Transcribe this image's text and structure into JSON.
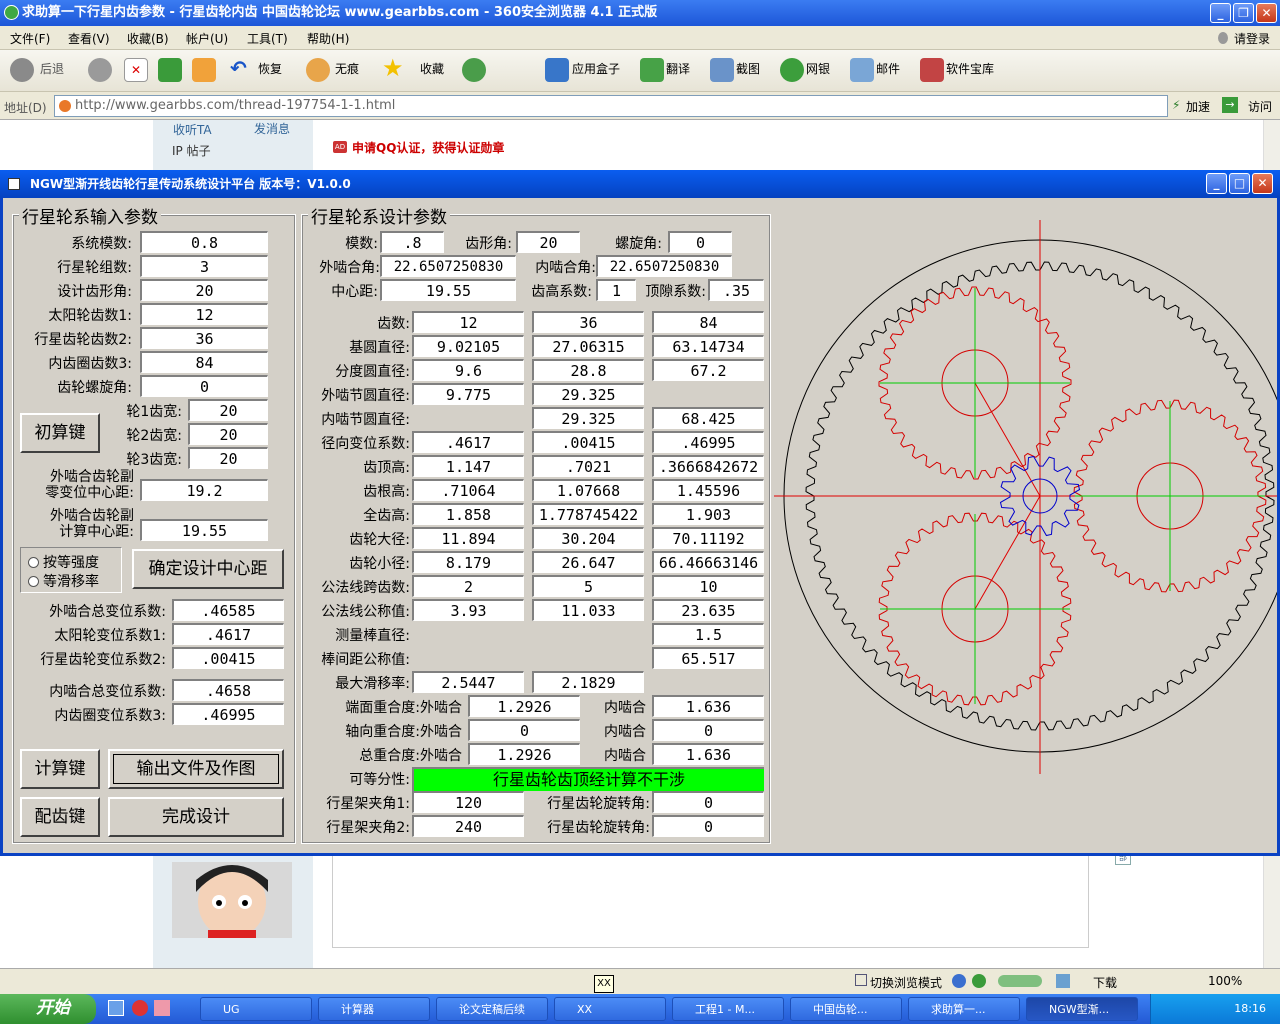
{
  "browser": {
    "title": "求助算一下行星内齿参数 - 行星齿轮内齿 中国齿轮论坛 www.gearbbs.com - 360安全浏览器 4.1 正式版",
    "menu": [
      "文件(F)",
      "查看(V)",
      "收藏(B)",
      "帐户(U)",
      "工具(T)",
      "帮助(H)"
    ],
    "login": "请登录",
    "toolbar": {
      "back": "后退",
      "restore": "恢复",
      "noTrace": "无痕",
      "favorites": "收藏",
      "appBox": "应用盒子",
      "translate": "翻译",
      "screenshot": "截图",
      "bank": "网银",
      "mail": "邮件",
      "softLib": "软件宝库"
    },
    "address_label": "地址(D)",
    "url": "http://www.gearbbs.com/thread-197754-1-1.html",
    "accelerate": "加速",
    "visit": "访问"
  },
  "web": {
    "listen": "收听TA",
    "message": "发消息",
    "ip_posts": "IP 帖子",
    "qq_promo": "申请QQ认证，获得认证勋章",
    "ad_badge": "AD"
  },
  "statusbar": {
    "switch_mode": "切换浏览模式",
    "download": "下载",
    "zoom": "100%"
  },
  "taskbar": {
    "start": "开始",
    "tasks": [
      "UG",
      "计算器",
      "论文定稿后续",
      "XX",
      "工程1 - M...",
      "中国齿轮...",
      "求助算一...",
      "NGW型渐..."
    ],
    "time": "18:16",
    "tooltip": "XX"
  },
  "app": {
    "title": "NGW型渐开线齿轮行星传动系统设计平台   版本号：V1.0.0",
    "input_group": {
      "title": "行星轮系输入参数",
      "fields": [
        {
          "label": "系统模数:",
          "value": "0.8"
        },
        {
          "label": "行星轮组数:",
          "value": "3"
        },
        {
          "label": "设计齿形角:",
          "value": "20"
        },
        {
          "label": "太阳轮齿数1:",
          "value": "12"
        },
        {
          "label": "行星齿轮齿数2:",
          "value": "36"
        },
        {
          "label": "内齿圈齿数3:",
          "value": "84"
        },
        {
          "label": "齿轮螺旋角:",
          "value": "0"
        }
      ],
      "widths": [
        {
          "label": "轮1齿宽:",
          "value": "20"
        },
        {
          "label": "轮2齿宽:",
          "value": "20"
        },
        {
          "label": "轮3齿宽:",
          "value": "20"
        }
      ],
      "calc_button": "初算键",
      "zero_center_label_1": "外啮合齿轮副",
      "zero_center_label_2": "零变位中心距:",
      "zero_center_value": "19.2",
      "calc_center_label_1": "外啮合齿轮副",
      "calc_center_label_2": "计算中心距:",
      "calc_center_value": "19.55",
      "radio_equal_strength": "按等强度",
      "radio_equal_slip": "等滑移率",
      "confirm_button": "确定设计中心距",
      "shift": [
        {
          "label": "外啮合总变位系数:",
          "value": ".46585"
        },
        {
          "label": "太阳轮变位系数1:",
          "value": ".4617"
        },
        {
          "label": "行星齿轮变位系数2:",
          "value": ".00415"
        },
        {
          "label": "内啮合总变位系数:",
          "value": ".4658"
        },
        {
          "label": "内齿圈变位系数3:",
          "value": ".46995"
        }
      ],
      "compute_button": "计算键",
      "output_button": "输出文件及作图",
      "match_button": "配齿键",
      "finish_button": "完成设计"
    },
    "design_group": {
      "title": "行星轮系设计参数",
      "module_label": "模数:",
      "module": ".8",
      "angle_label": "齿形角:",
      "angle": "20",
      "helix_label": "螺旋角:",
      "helix": "0",
      "ext_angle_label": "外啮合角:",
      "ext_angle": "22.6507250830",
      "int_angle_label": "内啮合角:",
      "int_angle": "22.6507250830",
      "center_label": "中心距:",
      "center": "19.55",
      "addendum_coef_label": "齿高系数:",
      "addendum_coef": "1",
      "clearance_label": "顶隙系数:",
      "clearance": ".35",
      "rows": [
        {
          "label": "齿数:",
          "v": [
            "12",
            "36",
            "84"
          ]
        },
        {
          "label": "基圆直径:",
          "v": [
            "9.02105",
            "27.06315",
            "63.14734"
          ]
        },
        {
          "label": "分度圆直径:",
          "v": [
            "9.6",
            "28.8",
            "67.2"
          ]
        },
        {
          "label": "外啮节圆直径:",
          "v": [
            "9.775",
            "29.325",
            ""
          ]
        },
        {
          "label": "内啮节圆直径:",
          "v": [
            "",
            "29.325",
            "68.425"
          ]
        },
        {
          "label": "径向变位系数:",
          "v": [
            ".4617",
            ".00415",
            ".46995"
          ]
        },
        {
          "label": "齿顶高:",
          "v": [
            "1.147",
            ".7021",
            ".3666842672"
          ]
        },
        {
          "label": "齿根高:",
          "v": [
            ".71064",
            "1.07668",
            "1.45596"
          ]
        },
        {
          "label": "全齿高:",
          "v": [
            "1.858",
            "1.778745422",
            "1.903"
          ]
        },
        {
          "label": "齿轮大径:",
          "v": [
            "11.894",
            "30.204",
            "70.11192"
          ]
        },
        {
          "label": "齿轮小径:",
          "v": [
            "8.179",
            "26.647",
            "66.46663146"
          ]
        },
        {
          "label": "公法线跨齿数:",
          "v": [
            "2",
            "5",
            "10"
          ]
        },
        {
          "label": "公法线公称值:",
          "v": [
            "3.93",
            "11.033",
            "23.635"
          ]
        },
        {
          "label": "测量棒直径:",
          "v": [
            "",
            "",
            "1.5"
          ]
        },
        {
          "label": "棒间距公称值:",
          "v": [
            "",
            "",
            "65.517"
          ]
        },
        {
          "label": "最大滑移率:",
          "v": [
            "2.5447",
            "2.1829",
            ""
          ]
        }
      ],
      "overlap": [
        {
          "label": "端面重合度:外啮合",
          "ext": "1.2926",
          "int_label": "内啮合",
          "int": "1.636"
        },
        {
          "label": "轴向重合度:外啮合",
          "ext": "0",
          "int_label": "内啮合",
          "int": "0"
        },
        {
          "label": "总重合度:外啮合",
          "ext": "1.2926",
          "int_label": "内啮合",
          "int": "1.636"
        }
      ],
      "assembly_label": "可等分性:",
      "assembly_msg": "行星齿轮齿顶经计算不干涉",
      "carrier": [
        {
          "label": "行星架夹角1:",
          "value": "120",
          "rot_label": "行星齿轮旋转角:",
          "rot": "0"
        },
        {
          "label": "行星架夹角2:",
          "value": "240",
          "rot_label": "行星齿轮旋转角:",
          "rot": "0"
        }
      ]
    },
    "drawing": {
      "colors": {
        "ring": "#000000",
        "planet": "#d40000",
        "sun": "#0000cc",
        "axis_red": "#e00000",
        "axis_green": "#00cc00"
      },
      "teeth": {
        "sun": 12,
        "planet": 36,
        "ring": 84
      }
    }
  }
}
